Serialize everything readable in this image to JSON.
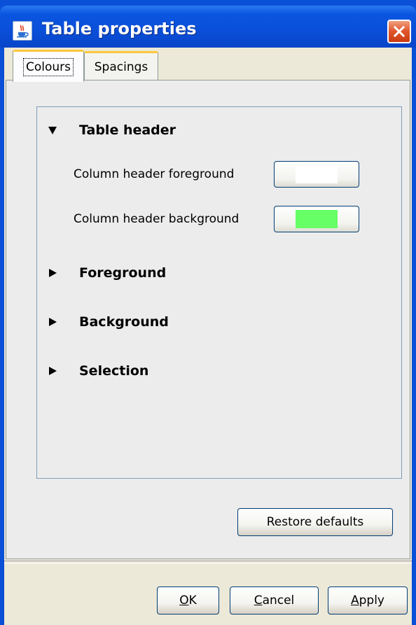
{
  "window": {
    "title": "Table properties",
    "icon": "java-coffee-cup-icon"
  },
  "tabs": [
    {
      "label": "Colours",
      "active": true
    },
    {
      "label": "Spacings",
      "active": false
    }
  ],
  "sections": [
    {
      "label": "Table header",
      "expanded": true,
      "properties": [
        {
          "label": "Column header foreground",
          "color": "#ffffff"
        },
        {
          "label": "Column header background",
          "color": "#66ff66"
        }
      ]
    },
    {
      "label": "Foreground",
      "expanded": false
    },
    {
      "label": "Background",
      "expanded": false
    },
    {
      "label": "Selection",
      "expanded": false
    }
  ],
  "buttons": {
    "restore_defaults": "Restore defaults",
    "ok": {
      "label": "OK",
      "mnemonic": "O"
    },
    "cancel": {
      "label": "Cancel",
      "mnemonic": "C"
    },
    "apply": {
      "label": "Apply",
      "mnemonic": "A"
    }
  }
}
